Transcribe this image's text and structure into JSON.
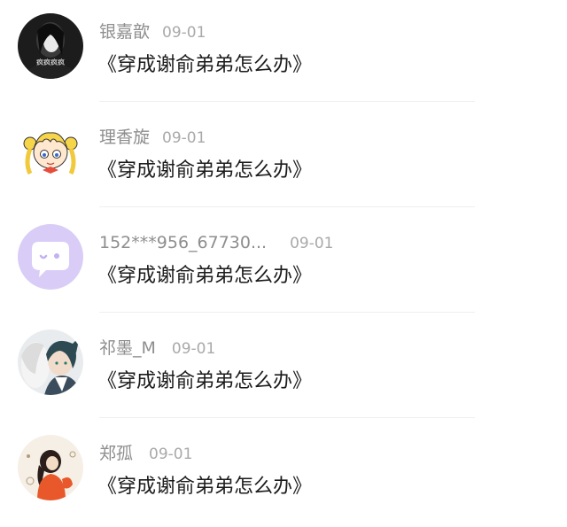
{
  "comments": [
    {
      "username": "银嘉歆",
      "date": "09-01",
      "text": "《穿成谢俞弟弟怎么办》",
      "avatar_icon": "portrait-photo-avatar",
      "avatar_caption": "疯疯疯疯"
    },
    {
      "username": "理香旋",
      "date": "09-01",
      "text": "《穿成谢俞弟弟怎么办》",
      "avatar_icon": "sailor-moon-cartoon-avatar"
    },
    {
      "username": "152***956_67730...",
      "date": "09-01",
      "text": "《穿成谢俞弟弟怎么办》",
      "avatar_icon": "chat-bubble-default-avatar"
    },
    {
      "username": "祁墨_M",
      "date": "09-01",
      "text": "《穿成谢俞弟弟怎么办》",
      "avatar_icon": "anime-character-avatar"
    },
    {
      "username": "郑孤",
      "date": "09-01",
      "text": "《穿成谢俞弟弟怎么办》",
      "avatar_icon": "illustrated-girl-avatar"
    }
  ],
  "colors": {
    "username": "#8e8e8e",
    "date": "#a9a9a9",
    "comment_text": "#1b1b1b",
    "divider": "#efefef",
    "default_avatar_bg": "#d9cdf7"
  }
}
